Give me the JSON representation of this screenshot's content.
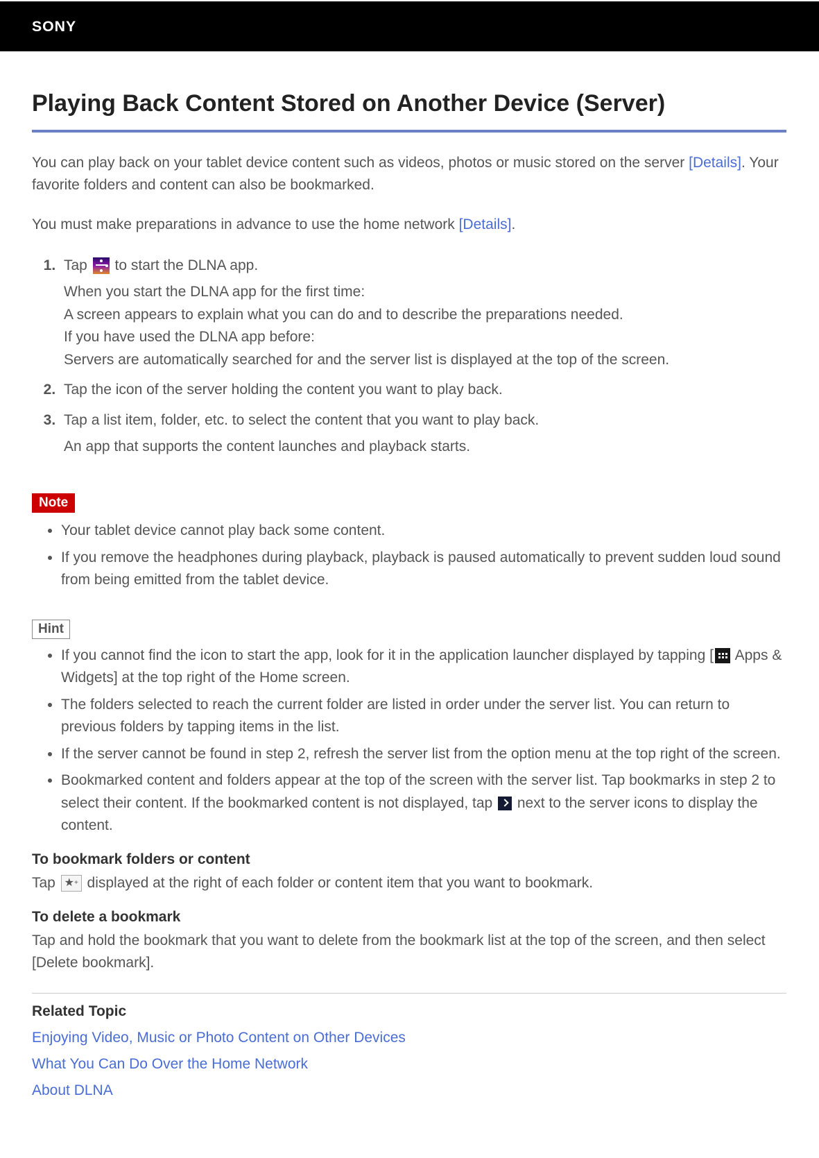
{
  "brand": "SONY",
  "title": "Playing Back Content Stored on Another Device (Server)",
  "intro1_a": "You can play back on your tablet device content such as videos, photos or music stored on the server ",
  "details_link": "[Details]",
  "intro1_b": ". Your favorite folders and content can also be bookmarked.",
  "intro2_a": "You must make preparations in advance to use the home network ",
  "intro2_b": ".",
  "steps": {
    "s1_a": "Tap ",
    "s1_b": " to start the DLNA app.",
    "s1_sub1": "When you start the DLNA app for the first time:",
    "s1_sub2": "A screen appears to explain what you can do and to describe the preparations needed.",
    "s1_sub3": "If you have used the DLNA app before:",
    "s1_sub4": "Servers are automatically searched for and the server list is displayed at the top of the screen.",
    "s2": "Tap the icon of the server holding the content you want to play back.",
    "s3": "Tap a list item, folder, etc. to select the content that you want to play back.",
    "s3_sub": "An app that supports the content launches and playback starts."
  },
  "note_label": "Note",
  "notes": {
    "n1": "Your tablet device cannot play back some content.",
    "n2": "If you remove the headphones during playback, playback is paused automatically to prevent sudden loud sound from being emitted from the tablet device."
  },
  "hint_label": "Hint",
  "hints": {
    "h1_a": "If you cannot find the icon to start the app, look for it in the application launcher displayed by tapping [",
    "h1_b": " Apps & Widgets] at the top right of the Home screen.",
    "h2": "The folders selected to reach the current folder are listed in order under the server list. You can return to previous folders by tapping items in the list.",
    "h3": "If the server cannot be found in step 2, refresh the server list from the option menu at the top right of the screen.",
    "h4_a": "Bookmarked content and folders appear at the top of the screen with the server list. Tap bookmarks in step 2 to select their content. If the bookmarked content is not displayed, tap ",
    "h4_b": " next to the server icons to display the content."
  },
  "bookmark_head": "To bookmark folders or content",
  "bookmark_body_a": "Tap ",
  "bookmark_body_b": " displayed at the right of each folder or content item that you want to bookmark.",
  "delete_head": "To delete a bookmark",
  "delete_body": "Tap and hold the bookmark that you want to delete from the bookmark list at the top of the screen, and then select [Delete bookmark].",
  "related_head": "Related Topic",
  "related_links": {
    "r1": "Enjoying Video, Music or Photo Content on Other Devices",
    "r2": "What You Can Do Over the Home Network",
    "r3": "About DLNA"
  }
}
